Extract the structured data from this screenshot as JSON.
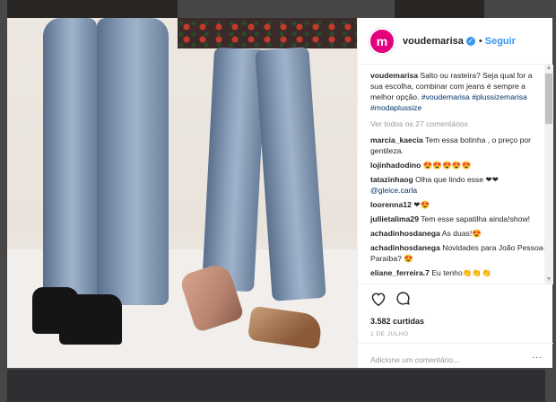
{
  "post": {
    "username": "voudemarisa",
    "follow_label": "Seguir",
    "avatar_text": "m",
    "caption_user": "voudemarisa",
    "caption_text": "Salto ou rasteira? Seja qual for a sua escolha, combinar com jeans é sempre a melhor opção.",
    "caption_tags": "#voudemarisa #plussizemarisa #modaplussize",
    "view_all": "Ver todos os 27 comentários",
    "comments": [
      {
        "user": "marcia_kaecia",
        "text": "Tem essa botinha , o preço por gentileza."
      },
      {
        "user": "lojinhadodino",
        "text": "😍😍😍😍😍"
      },
      {
        "user": "tatazinhaog",
        "text": "Olha que lindo esse ❤❤",
        "mention": "@gleice.carla"
      },
      {
        "user": "loorenna12",
        "text": "❤😍"
      },
      {
        "user": "jullietalima29",
        "text": "Tem esse sapatilha ainda!show!"
      },
      {
        "user": "achadinhosdanega",
        "text": "As duas!😍"
      },
      {
        "user": "achadinhosdanega",
        "text": "Novidades para João Pessoa-Paraíba? 😍"
      },
      {
        "user": "eliane_ferreira.7",
        "text": "Eu tenho👏👏👏"
      }
    ],
    "likes": "3.582 curtidas",
    "date": "1 DE JULHO",
    "add_comment_placeholder": "Adicione um comentário...",
    "more": "..."
  },
  "colors": {
    "brand": "#e4007c",
    "link": "#3897f0",
    "hashtag": "#003569"
  },
  "icons": [
    "heart-icon",
    "comment-icon",
    "verified-icon",
    "more-icon"
  ]
}
